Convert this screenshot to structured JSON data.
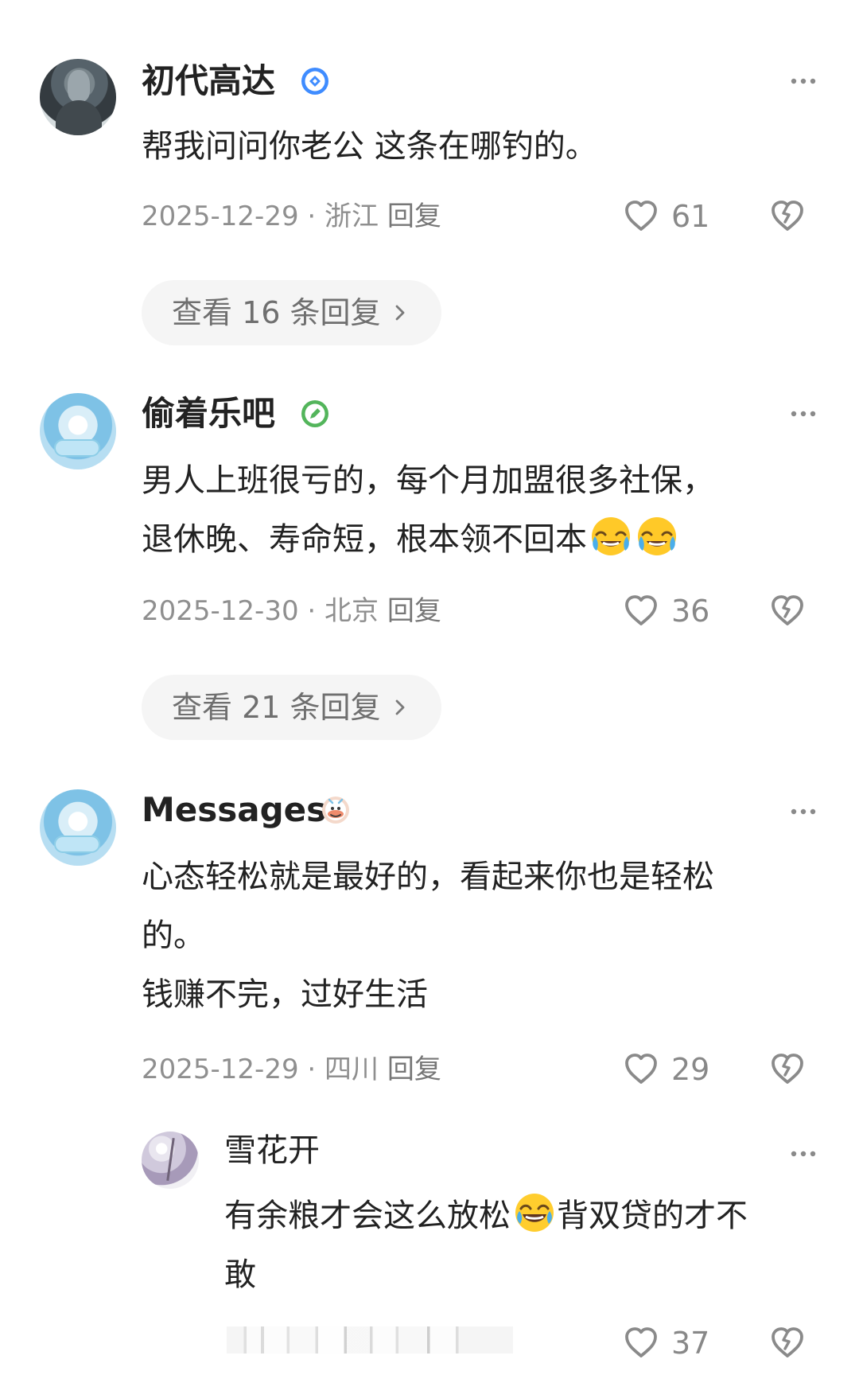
{
  "comments": [
    {
      "username": "初代高达",
      "badge_icon": "blue-diamond-badge-icon",
      "content_lines": [
        "帮我问问你老公 这条在哪钓的。"
      ],
      "date": "2025-12-29",
      "location": "浙江",
      "reply_label": "回复",
      "likes": "61",
      "expand_label": "查看 16 条回复"
    },
    {
      "username": "偷着乐吧",
      "badge_icon": "green-pencil-badge-icon",
      "content_lines": [
        "男人上班很亏的，每个月加盟很多社保，",
        "退休晚、寿命短，根本领不回本"
      ],
      "emoji_after_line_2": [
        "crying-laughing-face-icon",
        "crying-laughing-face-icon"
      ],
      "date": "2025-12-30",
      "location": "北京",
      "reply_label": "回复",
      "likes": "36",
      "expand_label": "查看 21 条回复"
    },
    {
      "username": "Messages",
      "badge_icon": "cow-mascot-badge-icon",
      "content_lines": [
        "心态轻松就是最好的，看起来你也是轻松",
        "的。",
        "钱赚不完，过好生活"
      ],
      "date": "2025-12-29",
      "location": "四川",
      "reply_label": "回复",
      "likes": "29"
    }
  ],
  "reply": {
    "username": "雪花开",
    "content_lines": [
      "有余粮才会这么放松",
      "背双贷的才不",
      "敢"
    ],
    "emoji_mid_line_1": "tears-of-joy-face-icon",
    "likes": "37"
  },
  "colors": {
    "text": "#222222",
    "meta": "#8f8f8f",
    "pill_bg": "#f5f5f5",
    "icon_gray": "#8a8a8a"
  }
}
